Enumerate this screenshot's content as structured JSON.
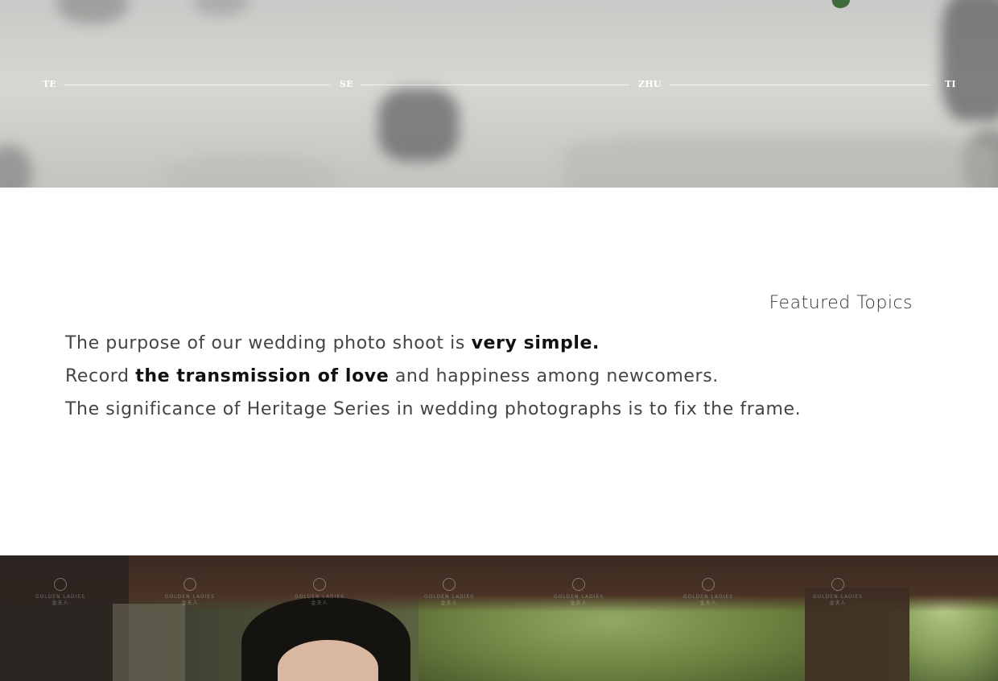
{
  "hero": {
    "nav": [
      {
        "label": "TE"
      },
      {
        "label": "SE"
      },
      {
        "label": "ZHU"
      },
      {
        "label": "TI"
      }
    ]
  },
  "section": {
    "heading": "Featured Topics",
    "lines": [
      {
        "pre": "The purpose of our wedding photo shoot is ",
        "bold": "very simple.",
        "post": ""
      },
      {
        "pre": "Record ",
        "bold": "the transmission of love",
        "post": " and happiness among newcomers."
      },
      {
        "pre": "The significance of Heritage Series in wedding photographs is to fix the frame.",
        "bold": "",
        "post": ""
      }
    ]
  },
  "photo": {
    "watermark_text": "GOLDEN LADIES",
    "watermark_sub": "金夫人"
  },
  "colors": {
    "text": "#444444",
    "bold_text": "#111111",
    "nav_text": "#ffffff"
  }
}
